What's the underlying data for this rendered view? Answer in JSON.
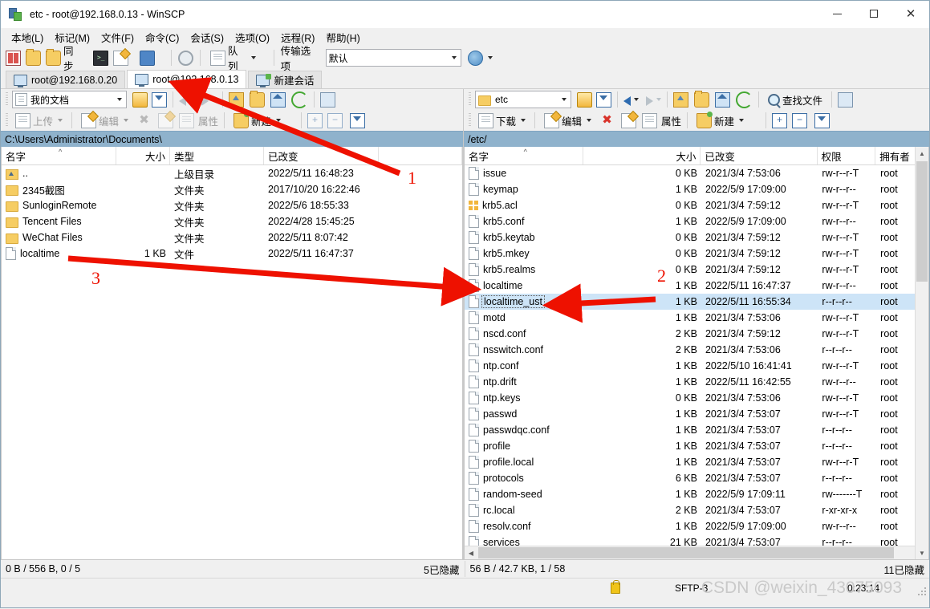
{
  "window": {
    "title": "etc - root@192.168.0.13 - WinSCP",
    "minimize": "—",
    "maximize": "□",
    "close": "✕"
  },
  "menu": [
    "本地(L)",
    "标记(M)",
    "文件(F)",
    "命令(C)",
    "会话(S)",
    "选项(O)",
    "远程(R)",
    "帮助(H)"
  ],
  "toolbar": {
    "sync_label": "同步",
    "queue_label": "队列",
    "transfer_options_label": "传输选项",
    "transfer_options_value": "默认"
  },
  "tabs": [
    {
      "label": "root@192.168.0.20",
      "active": false
    },
    {
      "label": "root@192.168.0.13",
      "active": true
    },
    {
      "label": "新建会话",
      "active": false
    }
  ],
  "left_pane": {
    "drive_combo": "我的文档",
    "toolbar2": {
      "upload": "上传",
      "edit": "编辑",
      "properties": "属性",
      "new": "新建"
    },
    "path": "C:\\Users\\Administrator\\Documents\\",
    "columns": [
      "名字",
      "大小",
      "类型",
      "已改变"
    ],
    "sort_col": 0,
    "rows": [
      {
        "icon": "parent-folder-icon",
        "name": "..",
        "size": "",
        "type": "上级目录",
        "changed": "2022/5/11  16:48:23"
      },
      {
        "icon": "folder-icon",
        "name": "2345截图",
        "size": "",
        "type": "文件夹",
        "changed": "2017/10/20  16:22:46"
      },
      {
        "icon": "folder-icon",
        "name": "SunloginRemote",
        "size": "",
        "type": "文件夹",
        "changed": "2022/5/6  18:55:33"
      },
      {
        "icon": "folder-icon",
        "name": "Tencent Files",
        "size": "",
        "type": "文件夹",
        "changed": "2022/4/28  15:45:25"
      },
      {
        "icon": "folder-icon",
        "name": "WeChat Files",
        "size": "",
        "type": "文件夹",
        "changed": "2022/5/11  8:07:42"
      },
      {
        "icon": "file-icon",
        "name": "localtime",
        "size": "1 KB",
        "type": "文件",
        "changed": "2022/5/11  16:47:37"
      }
    ],
    "status_left": "0 B / 556 B,  0 / 5",
    "status_right": "5已隐藏"
  },
  "right_pane": {
    "dir_combo": "etc",
    "find_files": "查找文件",
    "toolbar2": {
      "download": "下载",
      "edit": "编辑",
      "properties": "属性",
      "new": "新建"
    },
    "path": "/etc/",
    "columns": [
      "名字",
      "大小",
      "已改变",
      "权限",
      "拥有者"
    ],
    "sort_col": 0,
    "rows": [
      {
        "icon": "file-icon",
        "name": "issue",
        "size": "0 KB",
        "changed": "2021/3/4 7:53:06",
        "perm": "rw-r--r-T",
        "owner": "root",
        "selected": false
      },
      {
        "icon": "file-icon",
        "name": "keymap",
        "size": "1 KB",
        "changed": "2022/5/9 17:09:00",
        "perm": "rw-r--r--",
        "owner": "root",
        "selected": false
      },
      {
        "icon": "multi-file-icon",
        "name": "krb5.acl",
        "size": "0 KB",
        "changed": "2021/3/4 7:59:12",
        "perm": "rw-r--r-T",
        "owner": "root",
        "selected": false
      },
      {
        "icon": "file-icon",
        "name": "krb5.conf",
        "size": "1 KB",
        "changed": "2022/5/9 17:09:00",
        "perm": "rw-r--r--",
        "owner": "root",
        "selected": false
      },
      {
        "icon": "file-icon",
        "name": "krb5.keytab",
        "size": "0 KB",
        "changed": "2021/3/4 7:59:12",
        "perm": "rw-r--r-T",
        "owner": "root",
        "selected": false
      },
      {
        "icon": "file-icon",
        "name": "krb5.mkey",
        "size": "0 KB",
        "changed": "2021/3/4 7:59:12",
        "perm": "rw-r--r-T",
        "owner": "root",
        "selected": false
      },
      {
        "icon": "file-icon",
        "name": "krb5.realms",
        "size": "0 KB",
        "changed": "2021/3/4 7:59:12",
        "perm": "rw-r--r-T",
        "owner": "root",
        "selected": false
      },
      {
        "icon": "file-icon",
        "name": "localtime",
        "size": "1 KB",
        "changed": "2022/5/11 16:47:37",
        "perm": "rw-r--r--",
        "owner": "root",
        "selected": false
      },
      {
        "icon": "file-icon",
        "name": "localtime_ust",
        "size": "1 KB",
        "changed": "2022/5/11 16:55:34",
        "perm": "r--r--r--",
        "owner": "root",
        "selected": true
      },
      {
        "icon": "file-icon",
        "name": "motd",
        "size": "1 KB",
        "changed": "2021/3/4 7:53:06",
        "perm": "rw-r--r-T",
        "owner": "root",
        "selected": false
      },
      {
        "icon": "file-icon",
        "name": "nscd.conf",
        "size": "2 KB",
        "changed": "2021/3/4 7:59:12",
        "perm": "rw-r--r-T",
        "owner": "root",
        "selected": false
      },
      {
        "icon": "file-icon",
        "name": "nsswitch.conf",
        "size": "2 KB",
        "changed": "2021/3/4 7:53:06",
        "perm": "r--r--r--",
        "owner": "root",
        "selected": false
      },
      {
        "icon": "file-icon",
        "name": "ntp.conf",
        "size": "1 KB",
        "changed": "2022/5/10 16:41:41",
        "perm": "rw-r--r-T",
        "owner": "root",
        "selected": false
      },
      {
        "icon": "file-icon",
        "name": "ntp.drift",
        "size": "1 KB",
        "changed": "2022/5/11 16:42:55",
        "perm": "rw-r--r--",
        "owner": "root",
        "selected": false
      },
      {
        "icon": "file-icon",
        "name": "ntp.keys",
        "size": "0 KB",
        "changed": "2021/3/4 7:53:06",
        "perm": "rw-r--r-T",
        "owner": "root",
        "selected": false
      },
      {
        "icon": "file-icon",
        "name": "passwd",
        "size": "1 KB",
        "changed": "2021/3/4 7:53:07",
        "perm": "rw-r--r-T",
        "owner": "root",
        "selected": false
      },
      {
        "icon": "file-icon",
        "name": "passwdqc.conf",
        "size": "1 KB",
        "changed": "2021/3/4 7:53:07",
        "perm": "r--r--r--",
        "owner": "root",
        "selected": false
      },
      {
        "icon": "file-icon",
        "name": "profile",
        "size": "1 KB",
        "changed": "2021/3/4 7:53:07",
        "perm": "r--r--r--",
        "owner": "root",
        "selected": false
      },
      {
        "icon": "file-icon",
        "name": "profile.local",
        "size": "1 KB",
        "changed": "2021/3/4 7:53:07",
        "perm": "rw-r--r-T",
        "owner": "root",
        "selected": false
      },
      {
        "icon": "file-icon",
        "name": "protocols",
        "size": "6 KB",
        "changed": "2021/3/4 7:53:07",
        "perm": "r--r--r--",
        "owner": "root",
        "selected": false
      },
      {
        "icon": "file-icon",
        "name": "random-seed",
        "size": "1 KB",
        "changed": "2022/5/9 17:09:11",
        "perm": "rw-------T",
        "owner": "root",
        "selected": false
      },
      {
        "icon": "file-icon",
        "name": "rc.local",
        "size": "2 KB",
        "changed": "2021/3/4 7:53:07",
        "perm": "r-xr-xr-x",
        "owner": "root",
        "selected": false
      },
      {
        "icon": "file-icon",
        "name": "resolv.conf",
        "size": "1 KB",
        "changed": "2022/5/9 17:09:00",
        "perm": "rw-r--r--",
        "owner": "root",
        "selected": false
      },
      {
        "icon": "file-icon",
        "name": "services",
        "size": "21 KB",
        "changed": "2021/3/4 7:53:07",
        "perm": "r--r--r--",
        "owner": "root",
        "selected": false
      }
    ],
    "status_left": "56 B / 42.7 KB,  1 / 58",
    "status_right": "11已隐藏"
  },
  "app_status": {
    "protocol": "SFTP-3",
    "elapsed": "0:23:14"
  },
  "annotations": {
    "markers": [
      "1",
      "2",
      "3"
    ],
    "color": "#ee1100"
  },
  "watermark": "CSDN @weixin_43075093"
}
